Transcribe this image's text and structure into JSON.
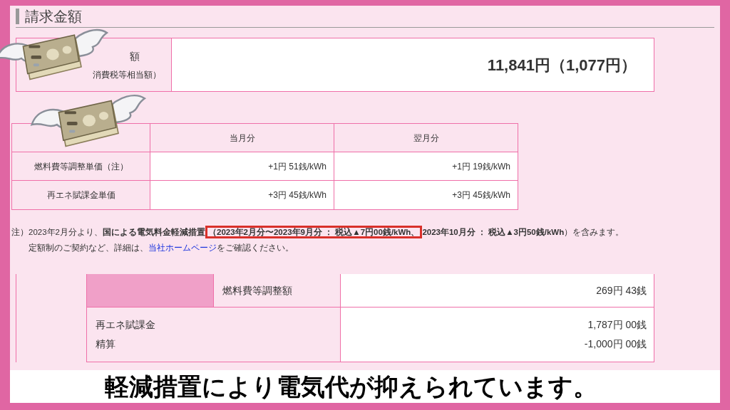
{
  "heading": "請求金額",
  "billing": {
    "label_lines": [
      "額",
      "消費税等相当額）"
    ],
    "amount": "11,841円（1,077円）"
  },
  "unit_price_table": {
    "columns": [
      "当月分",
      "翌月分"
    ],
    "rows": [
      {
        "label": "燃料費等調整単価（注）",
        "values": [
          "+1円 51銭/kWh",
          "+1円 19銭/kWh"
        ]
      },
      {
        "label": "再エネ賦課金単価",
        "values": [
          "+3円 45銭/kWh",
          "+3円 45銭/kWh"
        ]
      }
    ]
  },
  "note": {
    "mark": "注）",
    "segments": [
      {
        "text": "2023年2月分より、**国による電気料金軽減措置**",
        "highlighted": false
      },
      {
        "text": "**（2023年2月分〜2023年9月分 ： 税込▲7円00銭/kWh、**",
        "highlighted": true
      },
      {
        "text": "**2023年10月分 ： 税込▲3円50銭/kWh**）を含みます。",
        "highlighted": false
      }
    ],
    "line2_before": "定額制のご契約など、詳細は、",
    "link": "当社ホームページ",
    "line2_after": "をご確認ください。"
  },
  "charges": [
    {
      "label_lines": [
        "燃料費等調整額"
      ],
      "values": [
        "269円 43銭"
      ],
      "kind": "split"
    },
    {
      "label_lines": [
        "再エネ賦課金",
        "精算"
      ],
      "values": [
        "1,787円 00銭",
        "-1,000円 00銭"
      ],
      "kind": "full"
    }
  ],
  "subtitle": "軽減措置により電気代が抑えられています。"
}
